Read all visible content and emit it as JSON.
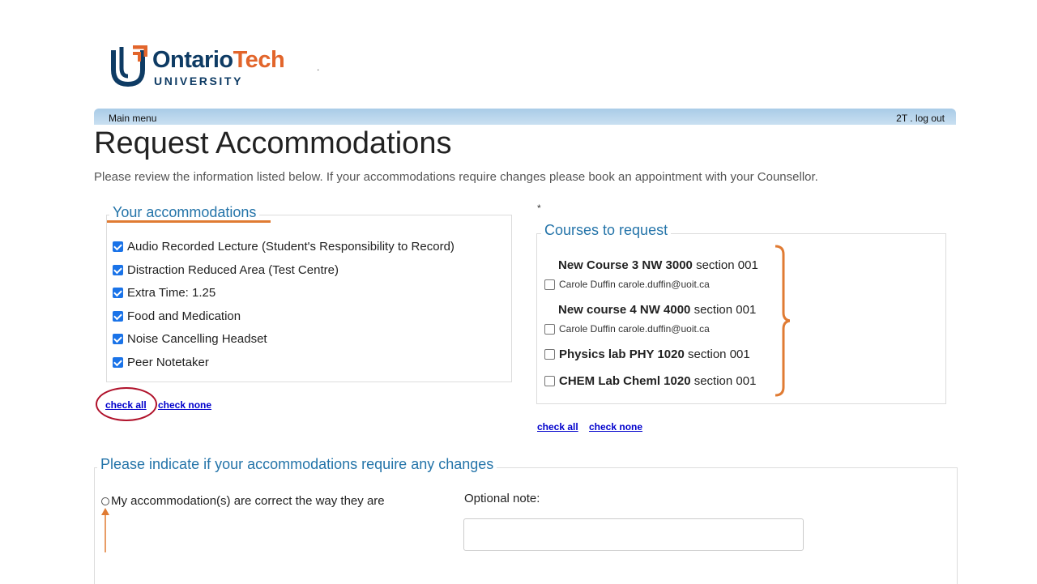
{
  "logo": {
    "name_part1": "Ontario",
    "name_part2": "Tech",
    "subtitle": "UNIVERSITY"
  },
  "header_dot": ".",
  "menubar": {
    "main_menu": "Main menu",
    "user_logout": "2T . log out"
  },
  "page": {
    "title": "Request Accommodations",
    "intro": "Please review the information listed below. If your accommodations require changes please book an appointment with your Counsellor."
  },
  "accommodations": {
    "legend": "Your accommodations",
    "items": [
      {
        "label": "Audio Recorded Lecture (Student's Responsibility to Record)",
        "checked": true
      },
      {
        "label": "Distraction Reduced Area (Test Centre)",
        "checked": true
      },
      {
        "label": "Extra Time: 1.25",
        "checked": true
      },
      {
        "label": "Food and Medication",
        "checked": true
      },
      {
        "label": "Noise Cancelling Headset",
        "checked": true
      },
      {
        "label": "Peer Notetaker",
        "checked": true
      }
    ],
    "check_all": "check all",
    "check_none": "check none"
  },
  "courses": {
    "asterisk": "*",
    "legend": "Courses to request",
    "items": [
      {
        "name": "New Course 3 NW 3000",
        "section": " section 001",
        "instructor": "Carole Duffin carole.duffin@uoit.ca"
      },
      {
        "name": "New course 4 NW 4000",
        "section": " section 001",
        "instructor": "Carole Duffin carole.duffin@uoit.ca"
      },
      {
        "name": "Physics lab PHY 1020",
        "section": " section 001"
      },
      {
        "name": "CHEM Lab Cheml 1020",
        "section": " section 001"
      }
    ],
    "check_all": "check all",
    "check_none": "check none"
  },
  "changes": {
    "legend": "Please indicate if your accommodations require any changes",
    "option_correct": "My accommodation(s) are correct the way they are",
    "optional_note_label": "Optional note:"
  },
  "colors": {
    "accent_blue": "#2474a9",
    "highlight_orange": "#e07b33",
    "highlight_red": "#b0122b",
    "link": "#0000cc"
  }
}
